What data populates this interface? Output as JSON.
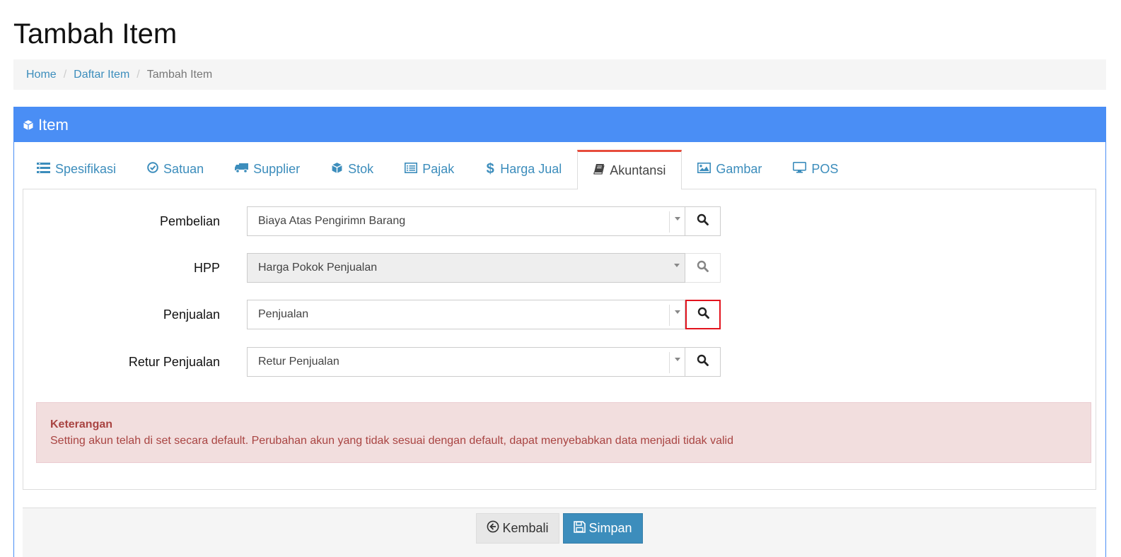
{
  "page": {
    "title": "Tambah Item"
  },
  "breadcrumb": {
    "home": "Home",
    "list": "Daftar Item",
    "current": "Tambah Item",
    "separator": "/"
  },
  "panel": {
    "title": "Item",
    "icon": "cube-icon"
  },
  "tabs": [
    {
      "label": "Spesifikasi",
      "icon": "list-icon"
    },
    {
      "label": "Satuan",
      "icon": "check-circle-icon"
    },
    {
      "label": "Supplier",
      "icon": "truck-icon"
    },
    {
      "label": "Stok",
      "icon": "cube-icon"
    },
    {
      "label": "Pajak",
      "icon": "list-alt-icon"
    },
    {
      "label": "Harga Jual",
      "icon": "dollar-icon"
    },
    {
      "label": "Akuntansi",
      "icon": "book-icon",
      "active": true
    },
    {
      "label": "Gambar",
      "icon": "image-icon"
    },
    {
      "label": "POS",
      "icon": "desktop-icon"
    }
  ],
  "accounts": [
    {
      "label": "Pembelian",
      "value": "Biaya Atas Pengirimn Barang",
      "disabled": false
    },
    {
      "label": "HPP",
      "value": "Harga Pokok Penjualan",
      "disabled": true
    },
    {
      "label": "Penjualan",
      "value": "Penjualan",
      "disabled": false,
      "highlighted": true
    },
    {
      "label": "Retur Penjualan",
      "value": "Retur Penjualan",
      "disabled": false
    }
  ],
  "alert": {
    "title": "Keterangan",
    "text": "Setting akun telah di set secara default. Perubahan akun yang tidak sesuai dengan default, dapat menyebabkan data menjadi tidak valid"
  },
  "buttons": {
    "back": "Kembali",
    "save": "Simpan"
  },
  "colors": {
    "primary": "#4a8ef5",
    "link": "#3c8dbc",
    "danger_bg": "#f2dede",
    "danger_text": "#a94442",
    "highlight": "#e3141e"
  }
}
